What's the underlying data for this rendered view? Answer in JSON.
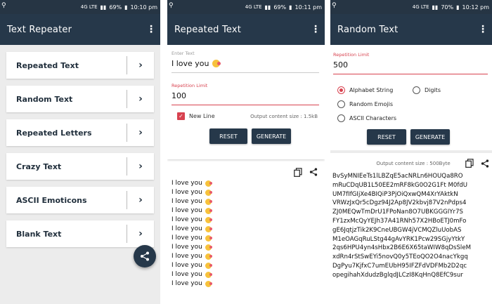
{
  "screen1": {
    "status": {
      "net": "4G LTE",
      "battery": "69%",
      "time": "10:10 pm"
    },
    "title": "Text Repeater",
    "items": [
      {
        "label": "Repeated Text"
      },
      {
        "label": "Random Text"
      },
      {
        "label": "Repeated Letters"
      },
      {
        "label": "Crazy Text"
      },
      {
        "label": "ASCII Emoticons"
      },
      {
        "label": "Blank Text"
      }
    ]
  },
  "screen2": {
    "status": {
      "net": "4G LTE",
      "battery": "69%",
      "time": "10:11 pm"
    },
    "title": "Repeated Text",
    "enter_text_label": "Enter Text",
    "enter_text_value": "I love you",
    "repetition_label": "Repetition Limit",
    "repetition_value": "100",
    "new_line_label": "New Line",
    "output_size": "Output content size : 1.5kB",
    "reset_label": "RESET",
    "generate_label": "GENERATE",
    "result_lines": [
      "I love you",
      "I love you",
      "I love you",
      "I love you",
      "I love you",
      "I love you",
      "I love you",
      "I love you",
      "I love you",
      "I love you",
      "I love you",
      "I love you"
    ]
  },
  "screen3": {
    "status": {
      "net": "4G LTE",
      "battery": "70%",
      "time": "10:12 pm"
    },
    "title": "Random Text",
    "repetition_label": "Repetition Limit",
    "repetition_value": "500",
    "options": {
      "alphabet": "Alphabet String",
      "digits": "Digits",
      "emojis": "Random Emojis",
      "ascii": "ASCII Characters"
    },
    "reset_label": "RESET",
    "generate_label": "GENERATE",
    "output_size": "Output content size : 500Byte",
    "random_lines": [
      "BvSyMNIEeTs1lLBZqE5acNRLn6HOUQa8RO",
      "mRuCDqUB1L50EE2mRF8kG0O2G1Ft M0fdU",
      "UM7fIfGIjXe4BIQiP3PjOiQxwQM4XrYAktkN",
      "VRWzJxQr5cDgz94J2Ap8JV2kbvj87V2nPdps4",
      "ZJ0MEQwTmDrU1FPoNan8O7UBKGGGIYr7S",
      "FY1zxMcQyYEJh37A41RNh57X2HBoETJ0mFo",
      "gE6JqtjzTik2K9CneUBGW4jVCMQZluUobAS",
      "M1eOAGqRuLStg44gAvYRK1Pcw29SGjyYtkY",
      "2qs6HPU4yn4sHbx2B6E6X65taWIW8qDsSleM",
      "xdRn4rStSwEYi5novQ0y5TEoQO2O4nacYkgq",
      "DgPyu7KjfxC7umEUbH95IFZFdVDFMb2D2qc",
      "opegihahXdudzBglqdJLCzI8KqHnQ8EfC9sur"
    ]
  }
}
